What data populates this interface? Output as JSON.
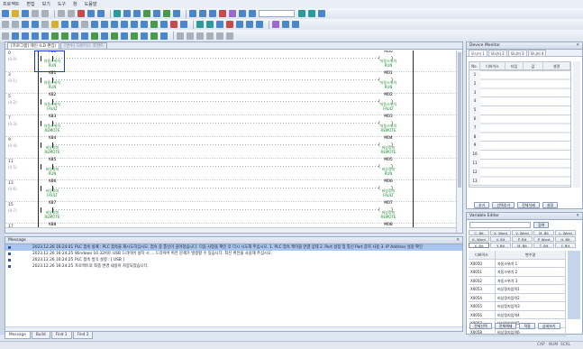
{
  "menu": [
    "프로젝트",
    "편집",
    "보기",
    "도구",
    "창",
    "도움말"
  ],
  "toolbar": {
    "zoom_value": ""
  },
  "doc_tabs": [
    "[프로그램] 메인 (LD 편집)",
    "[변수] 디바이스 코멘트"
  ],
  "ladder": {
    "colors": {
      "comment": "#1b8a2a",
      "rail": "#2a2a2a",
      "cursor": "#1a3ad0"
    },
    "rungs": [
      {
        "step": "0",
        "sub": "(0-0)",
        "contact": "P80",
        "contact_comment": [
          "자동스위치",
          "RUN"
        ],
        "coil": "M00",
        "coil_comment": [
          "자동스위치",
          "RUN"
        ]
      },
      {
        "step": "3",
        "sub": "(0-1)",
        "contact": "X81",
        "contact_comment": [
          "자동스위치",
          "RUN"
        ],
        "coil": "M01",
        "coil_comment": [
          "자동스위치",
          "RUN"
        ]
      },
      {
        "step": "5",
        "sub": "(0-2)",
        "contact": "X82",
        "contact_comment": [
          "자동스위치",
          "FAULT"
        ],
        "coil": "M02",
        "coil_comment": [
          "자동스위치",
          "FAULT"
        ]
      },
      {
        "step": "7",
        "sub": "(0-3)",
        "contact": "X83",
        "contact_comment": [
          "자동스위치",
          "REMOTE"
        ],
        "coil": "M03",
        "coil_comment": [
          "자동스위치",
          "REMOTE"
        ]
      },
      {
        "step": "9",
        "sub": "(0-4)",
        "contact": "X84",
        "contact_comment": [
          "비상정지",
          "REMOTE"
        ],
        "coil": "M04",
        "coil_comment": [
          "비상정지",
          "REMOTE"
        ]
      },
      {
        "step": "11",
        "sub": "(0-5)",
        "contact": "X85",
        "contact_comment": [
          "비상정지",
          "RUN"
        ],
        "coil": "M05",
        "coil_comment": [
          "비상정지",
          "RUN"
        ]
      },
      {
        "step": "13",
        "sub": "(0-6)",
        "contact": "X86",
        "contact_comment": [
          "비상정지",
          "FAULT"
        ],
        "coil": "M06",
        "coil_comment": [
          "비상정지",
          "FAULT"
        ]
      },
      {
        "step": "15",
        "sub": "(0-7)",
        "contact": "X87",
        "contact_comment": [
          "비상정지",
          "REMOTE"
        ],
        "coil": "M07",
        "coil_comment": [
          "비상정지",
          "REMOTE"
        ]
      },
      {
        "step": "17",
        "sub": "(0-8)",
        "contact": "X88",
        "contact_comment": [
          "비상정지",
          "RUN"
        ],
        "coil": "M08",
        "coil_comment": [
          "비상정지",
          "RUN"
        ]
      }
    ]
  },
  "device_monitor": {
    "title": "Device Monitor",
    "tabs": [
      "모니터 1",
      "모니터 2",
      "모니터 3",
      "모니터 4"
    ],
    "columns": [
      "No.",
      "디바이스",
      "타입",
      "값",
      "설명"
    ],
    "rows": [
      "1",
      "2",
      "3",
      "4",
      "5",
      "6",
      "7",
      "8",
      "9",
      "10",
      "11",
      "12",
      "13"
    ],
    "buttons": [
      "추가",
      "선택추가",
      "전체삭제",
      "설정"
    ]
  },
  "variable_editor": {
    "title": "Variable Editor",
    "search_button": "검색",
    "tabs": [
      "C. Bit",
      "X. Word",
      "V. Word",
      "M. Bit",
      "L. Word",
      "K. Word",
      "V. Bit",
      "P. Bit",
      "P. Word",
      "H. Bit",
      "X. Bit",
      "Y. Bit",
      "M. Bit",
      "T. Bit",
      "F. Bit"
    ],
    "columns": [
      "디바이스",
      "변수명"
    ],
    "rows": [
      {
        "dev": "X0050",
        "name": "자동스위치 1"
      },
      {
        "dev": "X0051",
        "name": "자동스위치 2"
      },
      {
        "dev": "X0052",
        "name": "자동스위치 3"
      },
      {
        "dev": "X0053",
        "name": "비상정지입력1"
      },
      {
        "dev": "X0054",
        "name": "비상정지입력2"
      },
      {
        "dev": "X0055",
        "name": "비상정지입력3"
      },
      {
        "dev": "X0056",
        "name": "비상정지입력4"
      },
      {
        "dev": "X0057",
        "name": "비상정지입력5"
      },
      {
        "dev": "X0058",
        "name": "비상정지입력6"
      }
    ],
    "buttons": [
      "전체선택",
      "전체해제",
      "적용",
      "상세보기"
    ]
  },
  "messages": {
    "title": "Message",
    "rows": [
      {
        "time": "2023.12.26 16:24:41",
        "text": "PLC 접속 실패 : PLC 접속을 재시도하십시오. 접속 중 통신이 끊어졌습니다. 다음 사항을 확인 후 다시 시도해 주십시오. 1. PLC 접속 케이블 연결 상태  2. Port 설정 및 통신 Port 중복 사용  3. IP Address 설정 확인",
        "selected": true
      },
      {
        "time": "2023.12.26 16:24:25",
        "text": "Windows 10 32비트 USB 드라이버 설치 시 ... 드라이버 버전 문제가 발생할 수 있습니다. 최신 버전을 사용해 주십시오.",
        "selected": false
      },
      {
        "time": "2023.12.26 16:24:25",
        "text": "PLC 접속 방식 설정 : [ USB ]",
        "selected": false
      },
      {
        "time": "2023.12.26 16:24:25",
        "text": "프로젝트의 최종 변경 내용이 저장되었습니다.",
        "selected": false
      }
    ]
  },
  "bottom_tabs": [
    "Message",
    "Build",
    "Find 1",
    "Find 2"
  ],
  "status": {
    "cap": "CAP",
    "num": "NUM",
    "scrl": "SCRL"
  }
}
